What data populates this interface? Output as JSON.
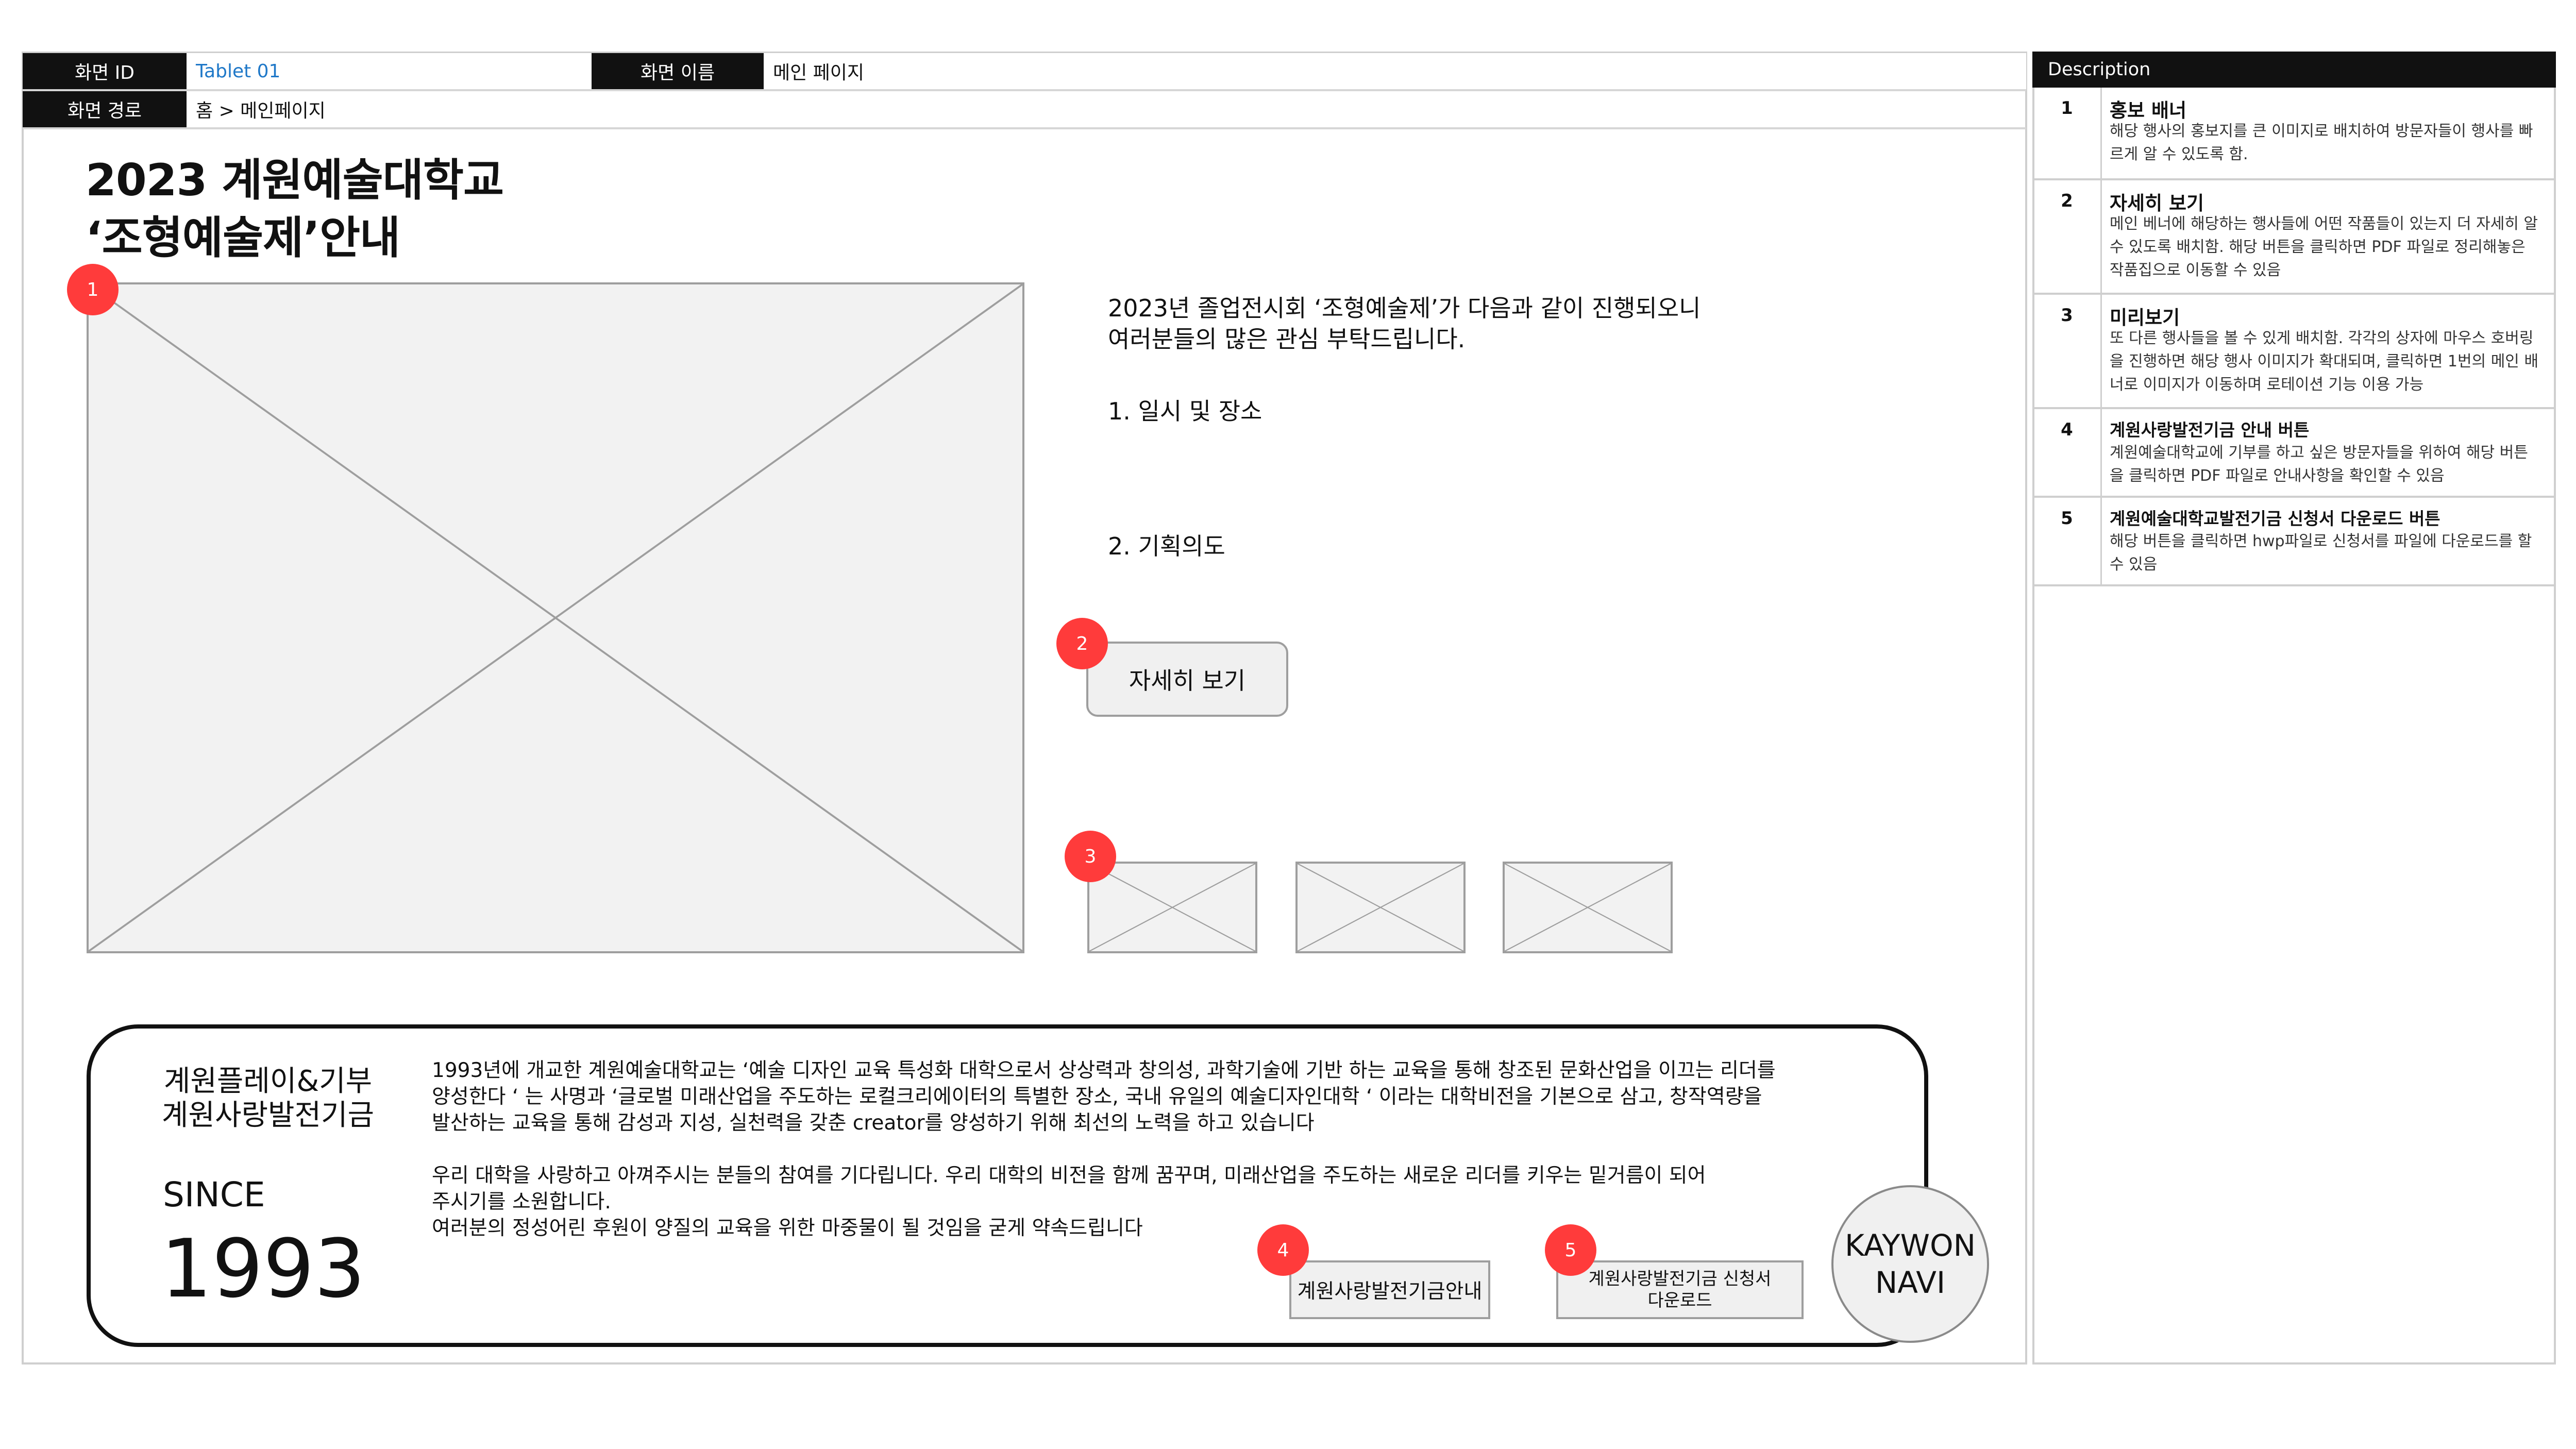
{
  "header": {
    "screen_id_label": "화면 ID",
    "screen_id_value": "Tablet 01",
    "screen_name_label": "화면 이름",
    "screen_name_value": "메인 페이지",
    "path_label": "화면 경로",
    "path_value": "홈 > 메인페이지"
  },
  "page": {
    "title_line1": "2023 계원예술대학교",
    "title_line2": "‘조형예술제’안내"
  },
  "intro": {
    "line1": "2023년 졸업전시회 ‘조형예술제’가 다음과 같이 진행되오니",
    "line2": "여러분들의 많은 관심 부탁드립니다.",
    "item1": "1. 일시 및 장소",
    "item2": "2. 기획의도"
  },
  "buttons": {
    "detail": "자세히 보기",
    "fund_info": "계원사랑발전기금안내",
    "fund_download_line1": "계원사랑발전기금 신청서",
    "fund_download_line2": "다운로드"
  },
  "badges": [
    "1",
    "2",
    "3",
    "4",
    "5"
  ],
  "donation": {
    "heading_line1": "계원플레이&기부",
    "heading_line2": "계원사랑발전기금",
    "since_label": "SINCE",
    "since_year": "1993",
    "para1_line1": "1993년에 개교한 계원예술대학교는 ‘예술 디자인 교육 특성화 대학으로서 상상력과 창의성, 과학기술에 기반 하는 교육을 통해 창조된 문화산업을 이끄는 리더를",
    "para1_line2": "양성한다 ‘ 는 사명과 ‘글로벌 미래산업을 주도하는 로컬크리에이터의 특별한 장소, 국내 유일의 예술디자인대학 ‘ 이라는 대학비전을 기본으로 삼고, 창작역량을",
    "para1_line3": "발산하는 교육을 통해 감성과 지성, 실천력을 갖춘 creator를 양성하기 위해 최선의 노력을 하고 있습니다",
    "para2_line1": "우리 대학을 사랑하고 아껴주시는 분들의 참여를 기다립니다. 우리 대학의 비전을 함께 꿈꾸며, 미래산업을 주도하는 새로운 리더를 키우는 밑거름이 되어",
    "para2_line2": "주시기를 소원합니다.",
    "para2_line3": "여러분의 정성어린 후원이 양질의 교육을 위한 마중물이 될 것임을 굳게 약속드립니다"
  },
  "navi": {
    "line1": "KAYWON",
    "line2": "NAVI"
  },
  "description": {
    "header": "Description",
    "items": [
      {
        "num": "1",
        "title": "홍보 배너",
        "text": "해당 행사의  홍보지를 큰 이미지로 배치하여 방문자들이 행사를 빠르게 알 수 있도록 함."
      },
      {
        "num": "2",
        "title": "자세히 보기",
        "text": "메인 베너에 해당하는 행사들에 어떤 작품들이 있는지 더 자세히 알 수 있도록 배치함. 해당 버튼을 클릭하면 PDF 파일로 정리해놓은 작품집으로 이동할 수 있음"
      },
      {
        "num": "3",
        "title": "미리보기",
        "text": "또 다른 행사들을 볼 수 있게 배치함. 각각의 상자에 마우스 호버링을 진행하면 해당 행사 이미지가 확대되며, 클릭하면 1번의 메인 배너로 이미지가 이동하며 로테이션 기능 이용 가능"
      },
      {
        "num": "4",
        "title": "계원사랑발전기금 안내 버튼",
        "text": "계원예술대학교에 기부를 하고 싶은 방문자들을 위하여 해당 버튼을 클릭하면 PDF 파일로 안내사항을 확인할 수 있음"
      },
      {
        "num": "5",
        "title": "계원예술대학교발전기금 신청서 다운로드 버튼",
        "text": "해당 버튼을 클릭하면 hwp파일로 신청서를 파일에 다운로드를 할 수 있음"
      }
    ]
  },
  "colors": {
    "badge": "#ff3b3b",
    "link_blue": "#1f78c8",
    "header_bg": "#111111",
    "placeholder_fill": "#f2f2f2",
    "border": "#cfcfcf"
  },
  "icons": {
    "image_placeholder": "image-placeholder-icon",
    "thumbnail_placeholder": "thumbnail-placeholder-icon"
  }
}
